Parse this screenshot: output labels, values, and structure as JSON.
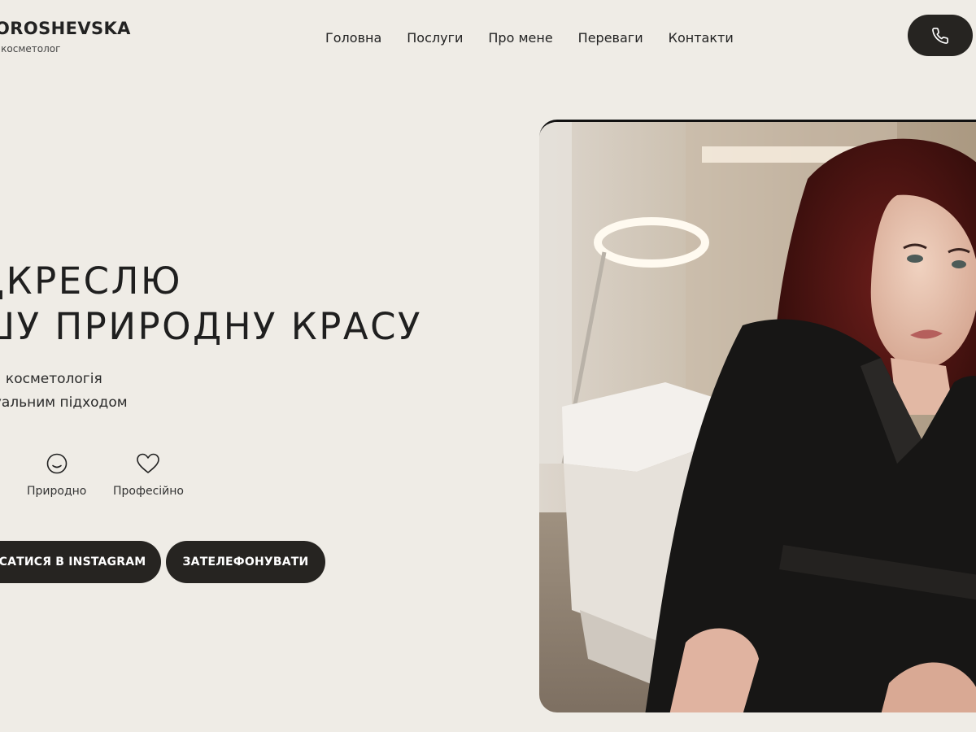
{
  "header": {
    "brand_name": "OROSHEVSKA",
    "brand_sub": "і косметолог",
    "nav": [
      "Головна",
      "Послуги",
      "Про мене",
      "Переваги",
      "Контакти"
    ]
  },
  "hero": {
    "headline_line1": "ДКРЕСЛЮ",
    "headline_line2": "ШУ ПРИРОДНУ КРАСУ",
    "sub_line1": "на косметологія",
    "sub_line2": "дуальним підходом",
    "features": [
      {
        "icon": "smile-icon",
        "label": "Природно"
      },
      {
        "icon": "heart-icon",
        "label": "Професійно"
      }
    ],
    "buttons": {
      "instagram": "СAТИСЯ В INSTAGRAM",
      "call": "ЗАТЕЛЕФОНУВАТИ"
    }
  },
  "colors": {
    "background": "#efece6",
    "dark": "#262421"
  }
}
